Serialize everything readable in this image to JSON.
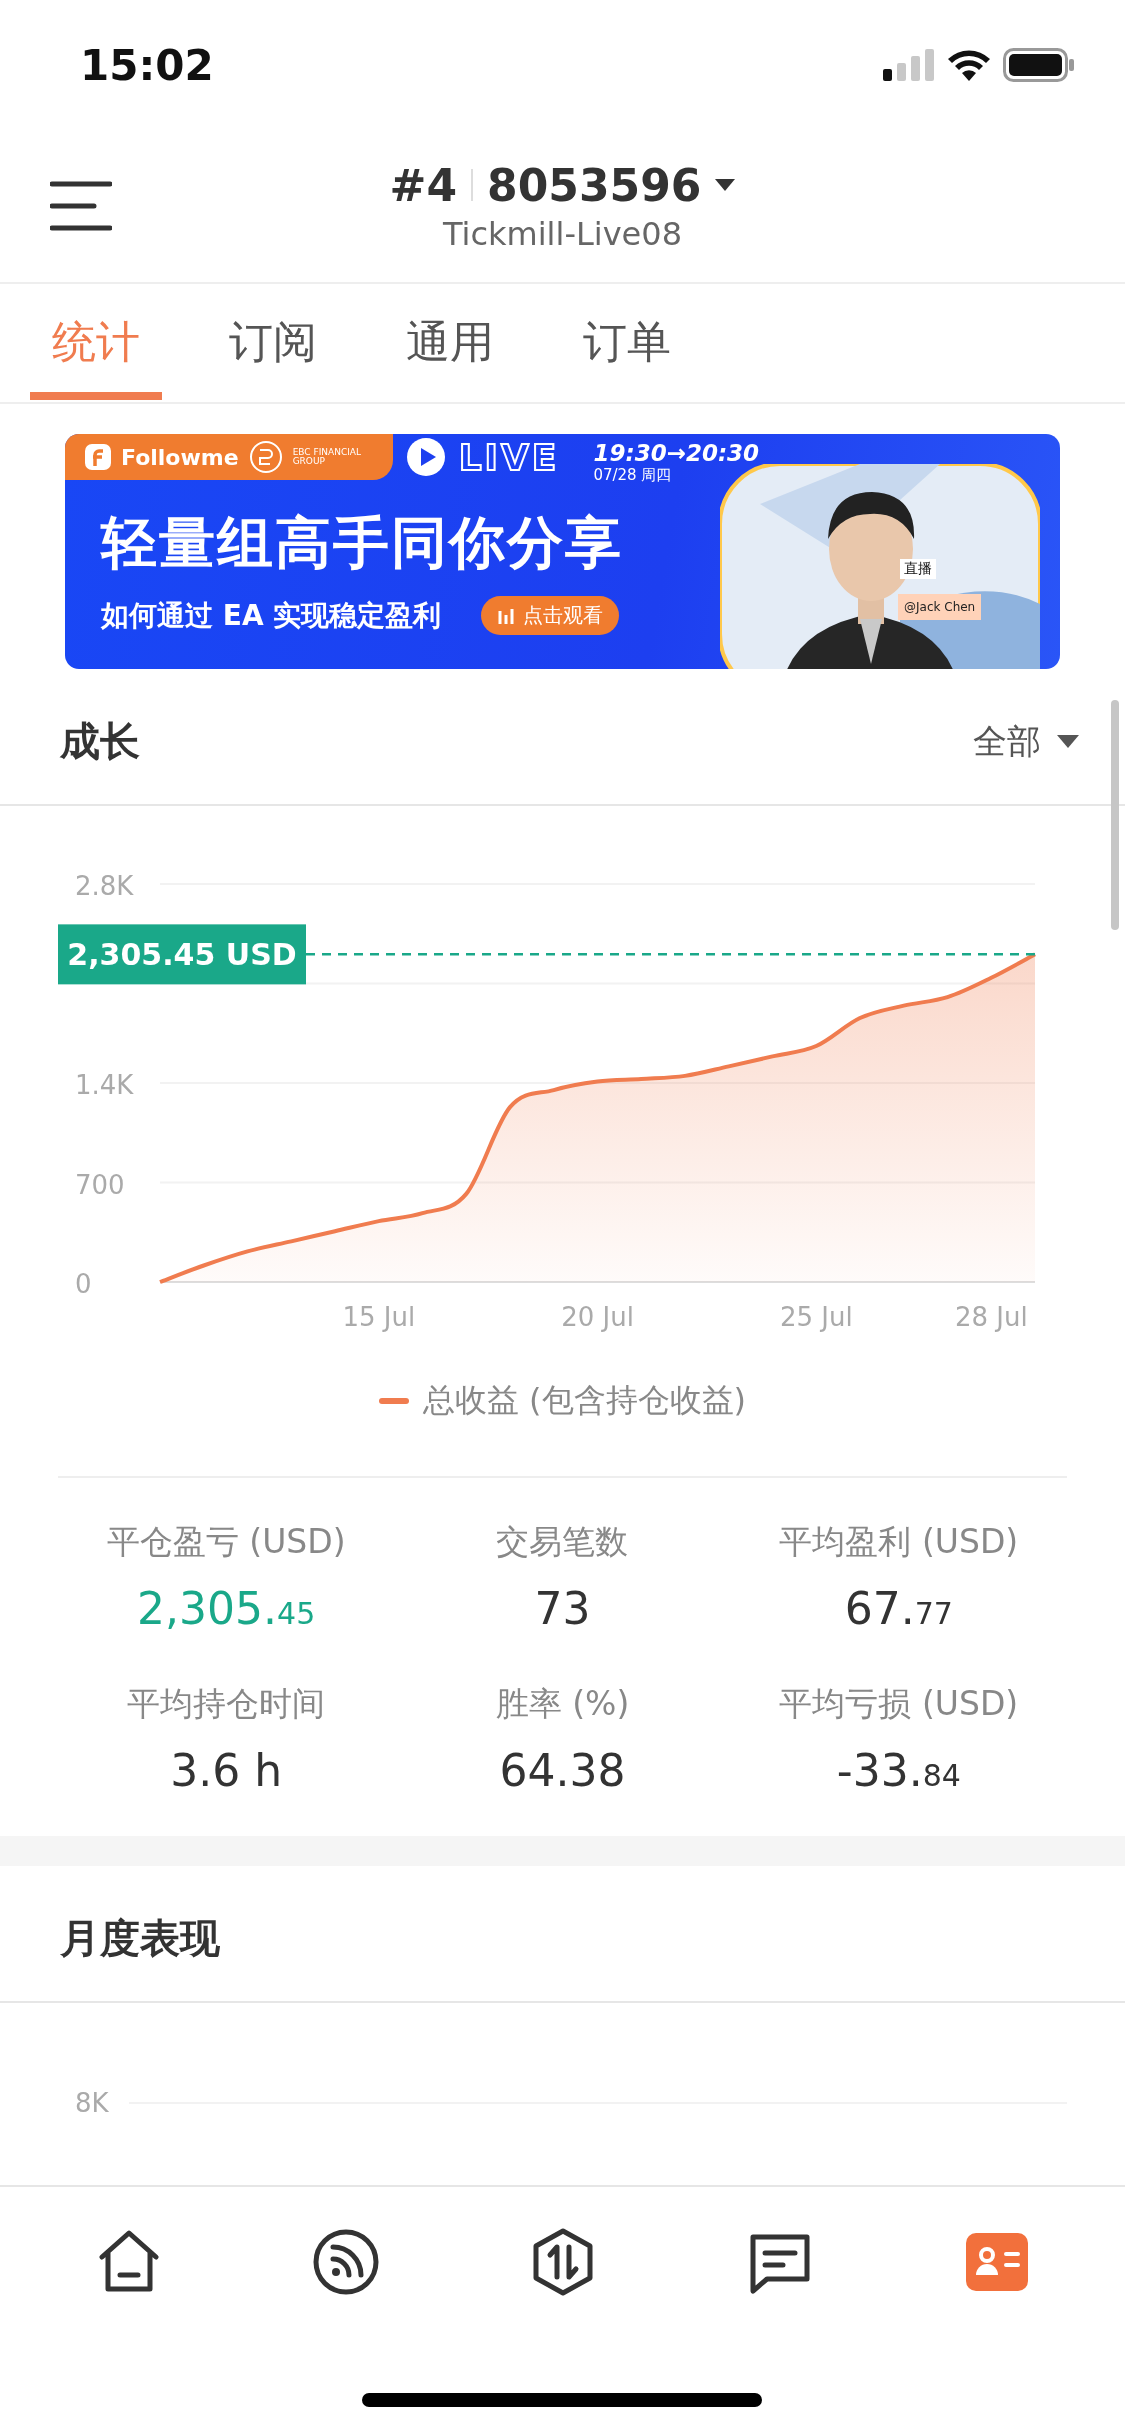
{
  "status_bar": {
    "time": "15:02"
  },
  "header": {
    "account_index": "#4",
    "account_number": "8053596",
    "server": "Tickmill-Live08"
  },
  "tabs": [
    {
      "label": "统计",
      "selected": true
    },
    {
      "label": "订阅",
      "selected": false
    },
    {
      "label": "通用",
      "selected": false
    },
    {
      "label": "订单",
      "selected": false
    }
  ],
  "banner": {
    "brand": "Followme",
    "partner": "EBC FINANCIAL GROUP",
    "live": "LIVE",
    "time": "19:30→20:30",
    "date": "07/28 周四",
    "headline": "轻量组高手同你分享",
    "subline": "如何通过 EA 实现稳定盈利",
    "cta": "点击观看",
    "live_tag": "直播",
    "host": "@Jack Chen"
  },
  "growth": {
    "title": "成长",
    "range": "全部",
    "chart_data": {
      "type": "area",
      "categories": [
        null,
        null,
        null,
        null,
        null,
        "15 Jul",
        null,
        null,
        null,
        null,
        "20 Jul",
        null,
        null,
        null,
        null,
        "25 Jul",
        null,
        null,
        null,
        "28 Jul",
        null
      ],
      "series": [
        {
          "name": "总收益 (包含持仓收益)",
          "color": "#f07c4f",
          "values": [
            0,
            116,
            215,
            286,
            357,
            428,
            484,
            620,
            1230,
            1350,
            1410,
            1428,
            1450,
            1517,
            1587,
            1660,
            1857,
            1944,
            2004,
            2140,
            2305
          ]
        }
      ],
      "ylim": [
        0,
        2800
      ],
      "yticks": [
        {
          "value": 0,
          "label": "0"
        },
        {
          "value": 700,
          "label": "700"
        },
        {
          "value": 1400,
          "label": "1.4K"
        },
        {
          "value": 2800,
          "label": "2.8K"
        }
      ],
      "ref_lines": [
        {
          "axis": "y",
          "value": 2305,
          "label": "2,305.45 USD",
          "color": "#1aa889"
        }
      ]
    }
  },
  "stats": [
    {
      "label": "平仓盈亏 (USD)",
      "value": "2,305.",
      "decimals": "45",
      "color": "#1aa889"
    },
    {
      "label": "交易笔数",
      "value": "73",
      "color": "#333333"
    },
    {
      "label": "平均盈利 (USD)",
      "value": "67.",
      "decimals": "77",
      "color": "#333333"
    },
    {
      "label": "平均持仓时间",
      "value": "3.6 h",
      "color": "#333333"
    },
    {
      "label": "胜率 (%)",
      "value": "64.38",
      "color": "#333333"
    },
    {
      "label": "平均亏损 (USD)",
      "value": "-33.",
      "decimals": "84",
      "color": "#333333"
    }
  ],
  "monthly": {
    "title": "月度表现",
    "axis_label": "8K"
  },
  "bottom_nav": [
    {
      "kind": "home",
      "selected": false
    },
    {
      "kind": "feed",
      "selected": false
    },
    {
      "kind": "trade",
      "selected": false
    },
    {
      "kind": "chat",
      "selected": false
    },
    {
      "kind": "profile",
      "selected": true
    }
  ]
}
